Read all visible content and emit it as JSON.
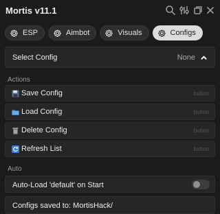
{
  "window": {
    "title": "Mortis v11.1"
  },
  "tabs": [
    {
      "label": "ESP",
      "active": false
    },
    {
      "label": "Aimbot",
      "active": false
    },
    {
      "label": "Visuals",
      "active": false
    },
    {
      "label": "Configs",
      "active": true
    }
  ],
  "config_select": {
    "label": "Select Config",
    "value": "None",
    "expanded": true
  },
  "actions": {
    "header": "Actions",
    "buttons": [
      {
        "label": "Save Config",
        "icon": "floppy-disk-icon",
        "kind": "button"
      },
      {
        "label": "Load Config",
        "icon": "folder-icon",
        "kind": "button"
      },
      {
        "label": "Delete Config",
        "icon": "trash-icon",
        "kind": "button"
      },
      {
        "label": "Refresh List",
        "icon": "refresh-icon",
        "kind": "button"
      }
    ]
  },
  "auto": {
    "header": "Auto",
    "toggle_label": "Auto-Load 'default' on Start",
    "toggle_on": false
  },
  "info": {
    "text": "Configs saved to: MortisHack/"
  },
  "colors": {
    "background": "#1b1b1c",
    "row": "#262628",
    "tab": "#2e2e30",
    "tab_active": "#dcdcdc",
    "text": "#ececec",
    "muted": "#9a9a9a"
  }
}
